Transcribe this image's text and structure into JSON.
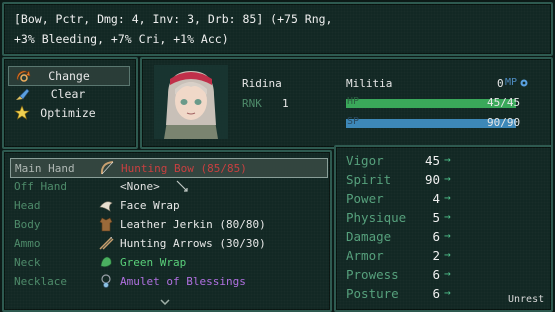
{
  "item_info": {
    "line1": "[Bow, Pctr, Dmg: 4, Inv: 3, Drb: 85] (+75 Rng,",
    "line2": "+3% Bleeding, +7% Cri, +1% Acc)"
  },
  "commands": {
    "items": [
      {
        "label": "Change",
        "icon": "change-icon",
        "selected": true
      },
      {
        "label": "Clear",
        "icon": "clear-icon",
        "selected": false
      },
      {
        "label": "Optimize",
        "icon": "optimize-icon",
        "selected": false
      }
    ]
  },
  "character": {
    "name": "Ridina",
    "class": "Militia",
    "rank_label": "RNK",
    "rank": "1",
    "mp_value": "0",
    "mp_label": "MP",
    "hp_label": "HP",
    "hp_text": "45/45",
    "hp_fraction": 1.0,
    "sp_label": "SP",
    "sp_text": "90/90",
    "sp_fraction": 1.0,
    "hp_color": "#3aa85a",
    "sp_color": "#3d88b8"
  },
  "equipment": {
    "rows": [
      {
        "slot": "Main Hand",
        "item": "Hunting Bow (85/85)",
        "icon": "bow-icon",
        "selected": true,
        "color": "#c84040"
      },
      {
        "slot": "Off Hand",
        "item": "<None>",
        "icon": "",
        "selected": false,
        "color": "#e0e0e0"
      },
      {
        "slot": "Head",
        "item": "Face Wrap",
        "icon": "face-wrap-icon",
        "selected": false,
        "color": "#e8e8e8"
      },
      {
        "slot": "Body",
        "item": "Leather Jerkin (80/80)",
        "icon": "leather-jerkin-icon",
        "selected": false,
        "color": "#e8e8e8"
      },
      {
        "slot": "Ammo",
        "item": "Hunting Arrows (30/30)",
        "icon": "arrows-icon",
        "selected": false,
        "color": "#e8e8e8"
      },
      {
        "slot": "Neck",
        "item": "Green Wrap",
        "icon": "green-wrap-icon",
        "selected": false,
        "color": "#5ad07a"
      },
      {
        "slot": "Necklace",
        "item": "Amulet of Blessings",
        "icon": "amulet-icon",
        "selected": false,
        "color": "#b070e0"
      }
    ]
  },
  "stats": {
    "rows": [
      {
        "name": "Vigor",
        "value": "45",
        "arrow": "→"
      },
      {
        "name": "Spirit",
        "value": "90",
        "arrow": "→"
      },
      {
        "name": "Power",
        "value": "4",
        "arrow": "→"
      },
      {
        "name": "Physique",
        "value": "5",
        "arrow": "→"
      },
      {
        "name": "Damage",
        "value": "6",
        "arrow": "→"
      },
      {
        "name": "Armor",
        "value": "2",
        "arrow": "→"
      },
      {
        "name": "Prowess",
        "value": "6",
        "arrow": "→"
      },
      {
        "name": "Posture",
        "value": "6",
        "arrow": "→"
      }
    ]
  },
  "status": {
    "label": "Unrest"
  }
}
